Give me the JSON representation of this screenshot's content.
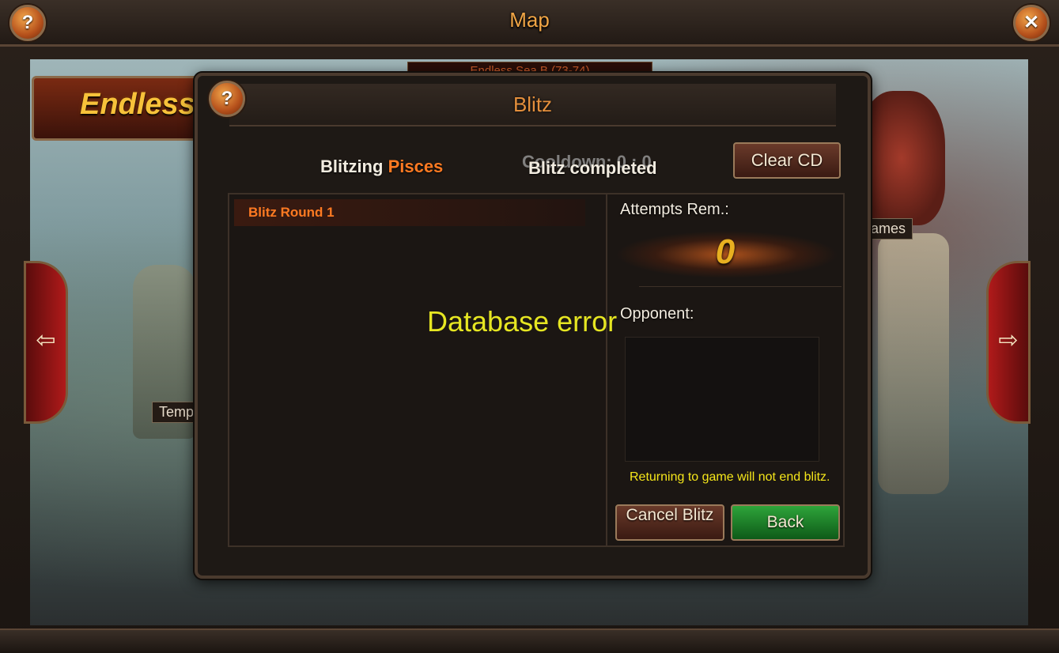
{
  "map": {
    "title": "Map",
    "help_label": "?",
    "close_label": "✕",
    "banner_text": "Endless",
    "region_label": "Endless Sea B (73-74)",
    "left_location_label": "Temp",
    "right_location_label": "lames",
    "prev_arrow": "⇦",
    "next_arrow": "⇨"
  },
  "blitz": {
    "title": "Blitz",
    "help_label": "?",
    "blitzing_prefix": "Blitzing",
    "blitzing_target": "Pisces",
    "cooldown_text": "Cooldown: 0 : 0",
    "status_text": "Blitz completed",
    "clear_cd_label": "Clear CD",
    "rounds": [
      {
        "label": "Blitz Round 1"
      }
    ],
    "attempts_label": "Attempts Rem.:",
    "attempts_value": "0",
    "opponent_label": "Opponent:",
    "note": "Returning to game will not end blitz.",
    "cancel_label": "Cancel Blitz",
    "back_label": "Back"
  },
  "overlay": {
    "error_text": "Database error"
  },
  "colors": {
    "accent_orange": "#ff7a22",
    "title_orange": "#e48f3c",
    "note_yellow": "#f5e61a",
    "error_yellow": "#e6e622",
    "back_green": "#2ea43a"
  }
}
